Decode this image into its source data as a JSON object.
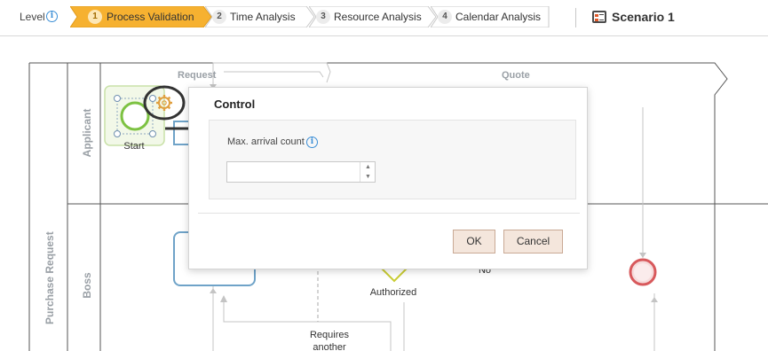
{
  "topbar": {
    "level_label": "Level",
    "steps": [
      {
        "number": "1",
        "label": "Process Validation",
        "active": true
      },
      {
        "number": "2",
        "label": "Time Analysis",
        "active": false
      },
      {
        "number": "3",
        "label": "Resource Analysis",
        "active": false
      },
      {
        "number": "4",
        "label": "Calendar Analysis",
        "active": false
      }
    ],
    "scenario_label": "Scenario 1"
  },
  "diagram": {
    "pool_label": "Purchase Request",
    "lanes": [
      "Applicant",
      "Boss"
    ],
    "phases": [
      "Request",
      "Quote"
    ],
    "start_label": "Start",
    "gateway_label": "Authorized",
    "no_label": "No",
    "requires_label_line1": "Requires",
    "requires_label_line2": "another"
  },
  "dialog": {
    "title": "Control",
    "field_label": "Max. arrival count",
    "field_value": "",
    "ok_label": "OK",
    "cancel_label": "Cancel"
  },
  "colors": {
    "active_step": "#f6b130",
    "start_event": "#7dc242",
    "end_event": "#d8595c",
    "task_border": "#6fa3c8",
    "accent_info": "#3c8fd6"
  },
  "icons": [
    "info-icon",
    "scenario-icon",
    "gear-icon",
    "arrow-right-icon",
    "spinner-up-icon",
    "spinner-down-icon"
  ]
}
